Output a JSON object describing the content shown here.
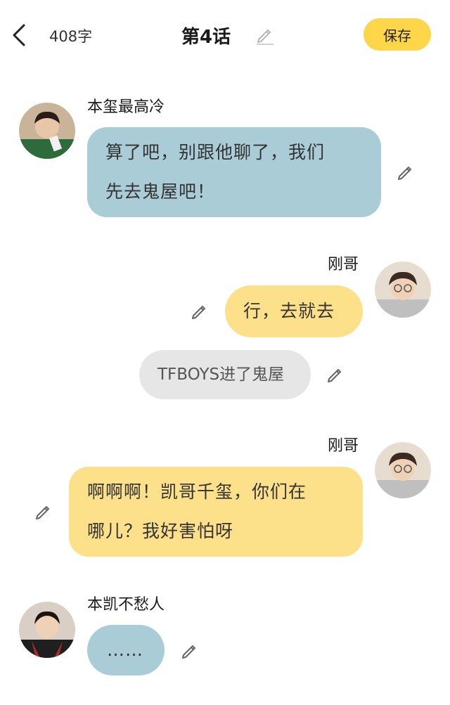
{
  "header": {
    "word_count": "408字",
    "chapter_title": "第4话",
    "save_label": "保存"
  },
  "messages": [
    {
      "speaker": "本玺最高冷",
      "side": "left",
      "color": "blue",
      "text_lines": [
        "算了吧，别跟他聊了，我们",
        "先去鬼屋吧！"
      ]
    },
    {
      "speaker": "刚哥",
      "side": "right",
      "color": "yellow",
      "text_lines": [
        "行，去就去"
      ]
    },
    {
      "type": "narration",
      "text_lines": [
        "TFBOYS进了鬼屋"
      ]
    },
    {
      "speaker": "刚哥",
      "side": "right",
      "color": "yellow",
      "text_lines": [
        "啊啊啊！凯哥千玺，你们在",
        "哪儿？我好害怕呀"
      ]
    },
    {
      "speaker": "本凯不愁人",
      "side": "left",
      "color": "blue",
      "text_lines": [
        "……"
      ]
    }
  ],
  "colors": {
    "blue_bubble": "#a9ccd7",
    "yellow_bubble": "#fde08a",
    "gray_bubble": "#e6e6e6",
    "accent": "#ffd64a"
  }
}
